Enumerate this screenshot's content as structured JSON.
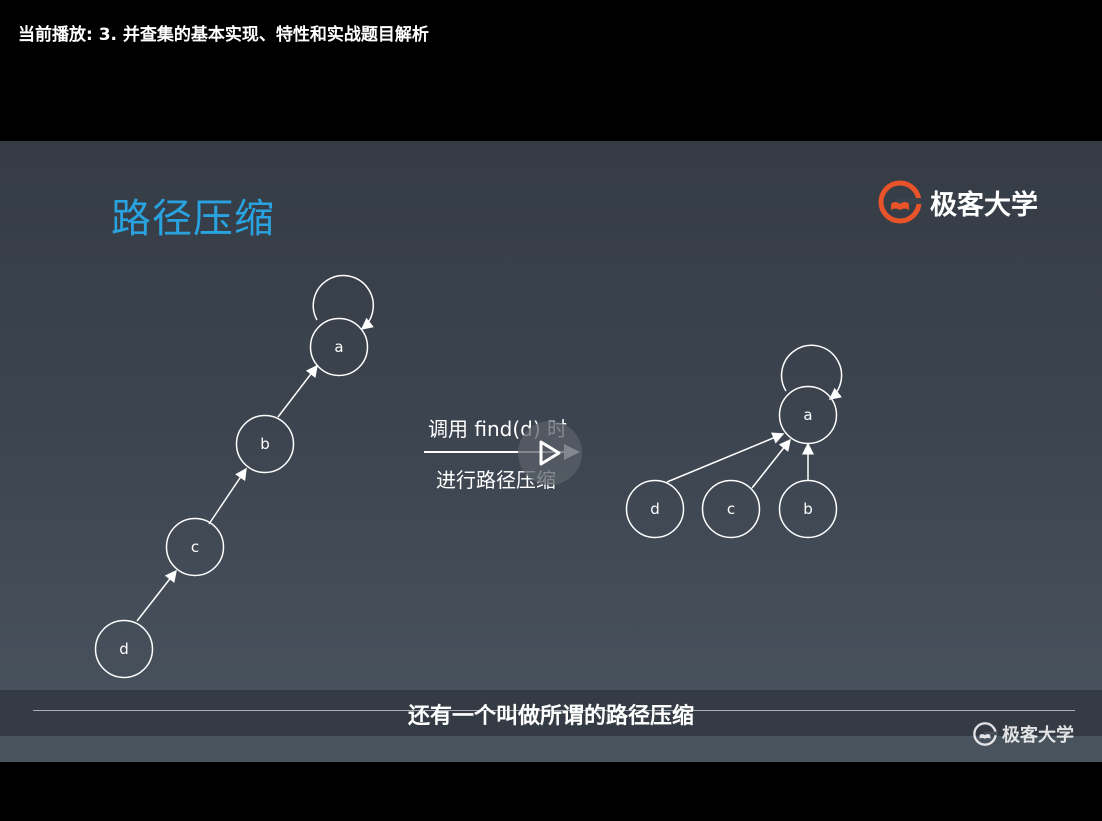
{
  "player": {
    "now_playing": "当前播放: 3. 并查集的基本实现、特性和实战题目解析"
  },
  "slide": {
    "title": "路径压缩",
    "brand": "极客大学",
    "step_line1": "调用 find(d) 时",
    "step_line2": "进行路径压缩",
    "subtitle": "还有一个叫做所谓的路径压缩",
    "watermark": "极客大学"
  },
  "diagram_before": {
    "nodes": [
      "a",
      "b",
      "c",
      "d"
    ]
  },
  "diagram_after": {
    "nodes": [
      "a",
      "d",
      "c",
      "b"
    ]
  },
  "colors": {
    "title_blue": "#29a3e0",
    "brand_orange": "#e8532a"
  },
  "icons": {
    "play": "play-icon",
    "logo": "geek-logo-icon"
  }
}
